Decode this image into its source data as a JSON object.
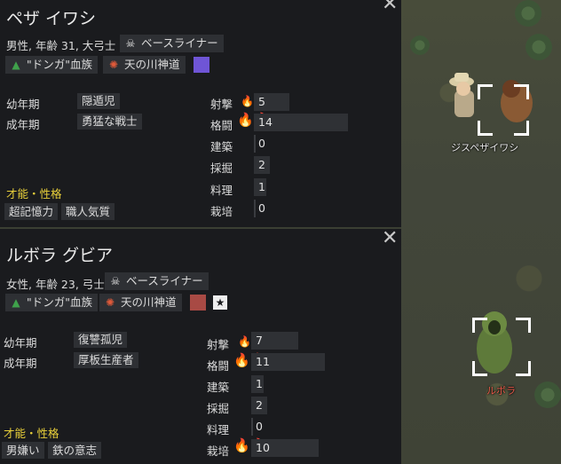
{
  "pawn1": {
    "name": "ペザ イワシ",
    "info": "男性, 年齢 31, 大弓士",
    "xenotype": "ベースライナー",
    "faction": "\"ドンガ\"血族",
    "ideology": "天の川神道",
    "favorite_color": "#6f55d6",
    "childhood_label": "幼年期",
    "childhood": "隠遁児",
    "adulthood_label": "成年期",
    "adulthood": "勇猛な戦士",
    "traits_header": "才能・性格",
    "traits": [
      "超記憶力",
      "職人気質"
    ],
    "skills": [
      {
        "name": "射撃",
        "value": "5",
        "passion": "minor"
      },
      {
        "name": "格闘",
        "value": "14",
        "passion": "major"
      },
      {
        "name": "建築",
        "value": "0",
        "passion": "none"
      },
      {
        "name": "採掘",
        "value": "2",
        "passion": "none"
      },
      {
        "name": "料理",
        "value": "1",
        "passion": "none"
      },
      {
        "name": "栽培",
        "value": "0",
        "passion": "none"
      }
    ],
    "map_label": "ジスペザイワシ"
  },
  "pawn2": {
    "name": "ルボラ グビア",
    "info": "女性, 年齢 23, 弓士",
    "xenotype": "ベースライナー",
    "faction": "\"ドンガ\"血族",
    "ideology": "天の川神道",
    "favorite_color": "#a84a44",
    "childhood_label": "幼年期",
    "childhood": "復讐孤児",
    "adulthood_label": "成年期",
    "adulthood": "厚板生産者",
    "traits_header": "才能・性格",
    "traits": [
      "男嫌い",
      "鉄の意志"
    ],
    "skills": [
      {
        "name": "射撃",
        "value": "7",
        "passion": "minor"
      },
      {
        "name": "格闘",
        "value": "11",
        "passion": "major"
      },
      {
        "name": "建築",
        "value": "1",
        "passion": "none"
      },
      {
        "name": "採掘",
        "value": "2",
        "passion": "none"
      },
      {
        "name": "料理",
        "value": "0",
        "passion": "none"
      },
      {
        "name": "栽培",
        "value": "10",
        "passion": "major"
      }
    ],
    "map_label": "ルボラ"
  },
  "icons": {
    "close": "close-icon",
    "xenotype": "skull-icon",
    "faction": "faction-arrow-icon",
    "ideology": "ideology-sun-icon",
    "passion": "flame-icon",
    "role": "star-badge-icon"
  }
}
